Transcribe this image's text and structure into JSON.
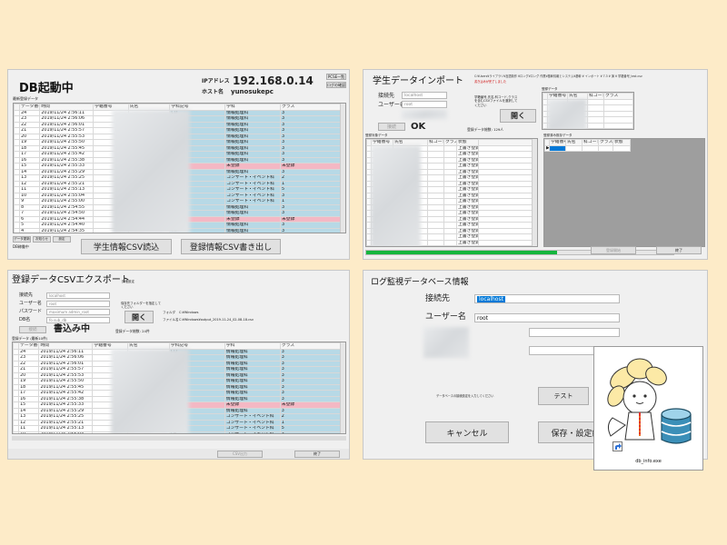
{
  "panel1": {
    "title": "DB起動中",
    "ip_label": "IPアドレス",
    "ip_value": "192.168.0.14",
    "host_label": "ホスト名",
    "host_value": "yunosukepc",
    "top_btn1": "PCSE一覧",
    "top_btn2": "ログの確認",
    "list_caption": "最新登録データ",
    "columns": [
      "データ番号",
      "時間",
      "学籍番号",
      "氏名",
      "学科記号",
      "学科",
      "クラス"
    ],
    "rows": [
      {
        "no": "24",
        "time": "2019/11/24 2:56:11",
        "code": "CD",
        "dept": "情報処理科",
        "cls": "3",
        "reg": false
      },
      {
        "no": "23",
        "time": "2019/11/24 2:56:06",
        "code": "CD",
        "dept": "情報処理科",
        "cls": "3",
        "reg": false
      },
      {
        "no": "22",
        "time": "2019/11/24 2:56:01",
        "code": "CD",
        "dept": "情報処理科",
        "cls": "3",
        "reg": false
      },
      {
        "no": "21",
        "time": "2019/11/24 2:55:57",
        "code": "CD",
        "dept": "情報処理科",
        "cls": "3",
        "reg": false
      },
      {
        "no": "20",
        "time": "2019/11/24 2:55:53",
        "code": "CD",
        "dept": "情報処理科",
        "cls": "3",
        "reg": false
      },
      {
        "no": "19",
        "time": "2019/11/24 2:55:50",
        "code": "CD",
        "dept": "情報処理科",
        "cls": "3",
        "reg": false
      },
      {
        "no": "18",
        "time": "2019/11/24 2:55:45",
        "code": "CD",
        "dept": "情報処理科",
        "cls": "3",
        "reg": false
      },
      {
        "no": "17",
        "time": "2019/11/24 2:55:42",
        "code": "CD",
        "dept": "情報処理科",
        "cls": "3",
        "reg": false
      },
      {
        "no": "16",
        "time": "2019/11/24 2:55:38",
        "code": "CD",
        "dept": "情報処理科",
        "cls": "3",
        "reg": false
      },
      {
        "no": "15",
        "time": "2019/11/24 2:55:33",
        "code": "未登録",
        "dept": "未登録",
        "cls": "未登録",
        "reg": true
      },
      {
        "no": "14",
        "time": "2019/11/24 2:55:29",
        "code": "CD",
        "dept": "情報処理科",
        "cls": "3",
        "reg": false
      },
      {
        "no": "13",
        "time": "2019/11/24 2:55:25",
        "code": "CE",
        "dept": "コンサート・イベント科",
        "cls": "2",
        "reg": false
      },
      {
        "no": "12",
        "time": "2019/11/24 2:55:21",
        "code": "CE",
        "dept": "コンサート・イベント科",
        "cls": "1",
        "reg": false
      },
      {
        "no": "11",
        "time": "2019/11/24 2:55:13",
        "code": "CE",
        "dept": "コンサート・イベント科",
        "cls": "5",
        "reg": false
      },
      {
        "no": "10",
        "time": "2019/11/24 2:55:04",
        "code": "CE",
        "dept": "コンサート・イベント科",
        "cls": "3",
        "reg": false
      },
      {
        "no": "9",
        "time": "2019/11/24 2:55:00",
        "code": "CE",
        "dept": "コンサート・イベント科",
        "cls": "1",
        "reg": false
      },
      {
        "no": "8",
        "time": "2019/11/24 2:54:55",
        "code": "CD",
        "dept": "情報処理科",
        "cls": "3",
        "reg": false
      },
      {
        "no": "7",
        "time": "2019/11/24 2:54:50",
        "code": "CD",
        "dept": "情報処理科",
        "cls": "3",
        "reg": false
      },
      {
        "no": "6",
        "time": "2019/11/24 2:54:44",
        "code": "未登録",
        "dept": "未登録",
        "cls": "未登録",
        "reg": true
      },
      {
        "no": "5",
        "time": "2019/11/24 2:54:40",
        "code": "CD",
        "dept": "情報処理科",
        "cls": "3",
        "reg": false
      },
      {
        "no": "4",
        "time": "2019/11/24 2:54:35",
        "code": "CD",
        "dept": "情報処理科",
        "cls": "3",
        "reg": false
      },
      {
        "no": "3",
        "time": "2019/11/24 2:54:29",
        "code": "CD",
        "dept": "情報処理科",
        "cls": "3",
        "reg": false
      },
      {
        "no": "2",
        "time": "2019/11/24 2:54:25",
        "code": "CD",
        "dept": "情報処理科",
        "cls": "3",
        "reg": false
      },
      {
        "no": "1",
        "time": "2019/11/24 2:54:21",
        "code": "CD",
        "dept": "情報処理科",
        "cls": "3",
        "reg": false
      }
    ],
    "small_btn1": "データ更新",
    "small_btn2": "お知らせ",
    "small_btn3": "設定",
    "status": "DB稼働中",
    "import_btn": "学生情報CSV読込",
    "export_btn": "登録情報CSV書き出し"
  },
  "panel2": {
    "title": "学生データインポート",
    "host_label": "接続先",
    "host_value": "localhost",
    "user_label": "ユーザー名",
    "user_value": "root",
    "connect_btn": "接続",
    "status": "OK",
    "path_text": "C:¥Users¥ライブラリ¥言語制作 ¥ロング¥ロング 作業¥基幹情報とシステム¥基幹 ¥ インポート ¥ 7.3 ¥ 演 ¥ 学籍番号_test.csv",
    "hint_text": "書き込みが完了しました",
    "open_hint": "学籍番号,氏名,科コード,クラス を含むCSVファイルを選択してください",
    "open_btn": "開く",
    "preview_caption": "登録データ",
    "preview_cols": [
      "学籍番号",
      "氏名",
      "科コード",
      "クラス"
    ],
    "count_label": "登録データ総数: 129人",
    "left_caption": "登録対象データ",
    "left_cols": [
      "学籍番号",
      "氏名",
      "科コード",
      "クラス",
      "状態"
    ],
    "left_rows": [
      "上書き登録",
      "上書き登録",
      "上書き登録",
      "上書き登録",
      "上書き登録",
      "上書き登録",
      "上書き登録",
      "上書き登録",
      "上書き登録",
      "上書き登録",
      "上書き登録",
      "上書き登録",
      "上書き登録",
      "上書き登録",
      "上書き登録",
      "上書き登録",
      "上書き登録",
      "上書き登録",
      "上書き登録",
      "上書き登録"
    ],
    "right_caption": "登録済み既存データ",
    "right_cols": [
      "学籍番号",
      "氏名",
      "科コード",
      "クラス",
      "状態"
    ],
    "progress": 0.62,
    "regist_btn": "登録開始",
    "close_btn": "終了"
  },
  "panel3": {
    "title": "登録データCSVエクスポート",
    "title_note": "詳細設定",
    "host_label": "接続先",
    "host_value": "localhost",
    "user_label": "ユーザー名",
    "user_value": "root",
    "pass_label": "パスワード",
    "pass_value": "maximum admin_root",
    "db_label": "DB名",
    "db_value": "fo.sub_db",
    "connect_btn": "接続",
    "status": "書込み中",
    "save_hint": "保存先フォルダーを指定してください",
    "open_btn": "開く",
    "folder_label": "フォルダ",
    "folder_value": "C:¥Windows",
    "file_label": "ファイル名",
    "file_value": "C:¥Windows¥output_2019-11-24_02-08-18.csv",
    "count_label": "登録データ総数: 24件",
    "list_caption": "登録データ (最新10件)",
    "columns": [
      "データ番号",
      "時間",
      "学籍番号",
      "氏名",
      "学科記号",
      "学科",
      "クラス"
    ],
    "rows": [
      {
        "no": "24",
        "time": "2019/11/24 2:56:11",
        "code": "CD",
        "dept": "情報処理科",
        "cls": "3",
        "reg": false
      },
      {
        "no": "23",
        "time": "2019/11/24 2:56:06",
        "code": "CD",
        "dept": "情報処理科",
        "cls": "3",
        "reg": false
      },
      {
        "no": "22",
        "time": "2019/11/24 2:56:01",
        "code": "CD",
        "dept": "情報処理科",
        "cls": "3",
        "reg": false
      },
      {
        "no": "21",
        "time": "2019/11/24 2:55:57",
        "code": "CD",
        "dept": "情報処理科",
        "cls": "3",
        "reg": false
      },
      {
        "no": "20",
        "time": "2019/11/24 2:55:53",
        "code": "CD",
        "dept": "情報処理科",
        "cls": "3",
        "reg": false
      },
      {
        "no": "19",
        "time": "2019/11/24 2:55:50",
        "code": "CD",
        "dept": "情報処理科",
        "cls": "3",
        "reg": false
      },
      {
        "no": "18",
        "time": "2019/11/24 2:55:45",
        "code": "CD",
        "dept": "情報処理科",
        "cls": "3",
        "reg": false
      },
      {
        "no": "17",
        "time": "2019/11/24 2:55:42",
        "code": "CD",
        "dept": "情報処理科",
        "cls": "3",
        "reg": false
      },
      {
        "no": "16",
        "time": "2019/11/24 2:55:38",
        "code": "CD",
        "dept": "情報処理科",
        "cls": "3",
        "reg": false
      },
      {
        "no": "15",
        "time": "2019/11/24 2:55:33",
        "code": "未登録",
        "dept": "未登録",
        "cls": "未登録",
        "reg": true
      },
      {
        "no": "14",
        "time": "2019/11/24 2:55:29",
        "code": "CD",
        "dept": "情報処理科",
        "cls": "3",
        "reg": false
      },
      {
        "no": "13",
        "time": "2019/11/24 2:55:25",
        "code": "CE",
        "dept": "コンサート・イベント科",
        "cls": "2",
        "reg": false
      },
      {
        "no": "12",
        "time": "2019/11/24 2:55:21",
        "code": "CE",
        "dept": "コンサート・イベント科",
        "cls": "1",
        "reg": false
      },
      {
        "no": "11",
        "time": "2019/11/24 2:55:13",
        "code": "CE",
        "dept": "コンサート・イベント科",
        "cls": "5",
        "reg": false
      },
      {
        "no": "10",
        "time": "2019/11/24 2:55:04",
        "code": "CE",
        "dept": "コンサート・イベント科",
        "cls": "3",
        "reg": false
      }
    ],
    "export_btn": "CSV出力",
    "close_btn": "終了"
  },
  "panel4": {
    "title": "ログ監視データベース情報",
    "host_label": "接続先",
    "host_value": "localhost",
    "user_label": "ユーザー名",
    "user_value": "root",
    "note": "データベースの接続設定を入力してください",
    "test_btn": "テスト",
    "cancel_btn": "キャンセル",
    "save_btn": "保存・設定終了"
  },
  "shortcut": {
    "label": "db_info.exe"
  },
  "colors": {
    "background": "#fdebc8",
    "cell_blue": "#b7d9e6",
    "cell_pink": "#f4b8c4",
    "progress_green": "#14b53d",
    "selection_blue": "#0078d7"
  }
}
